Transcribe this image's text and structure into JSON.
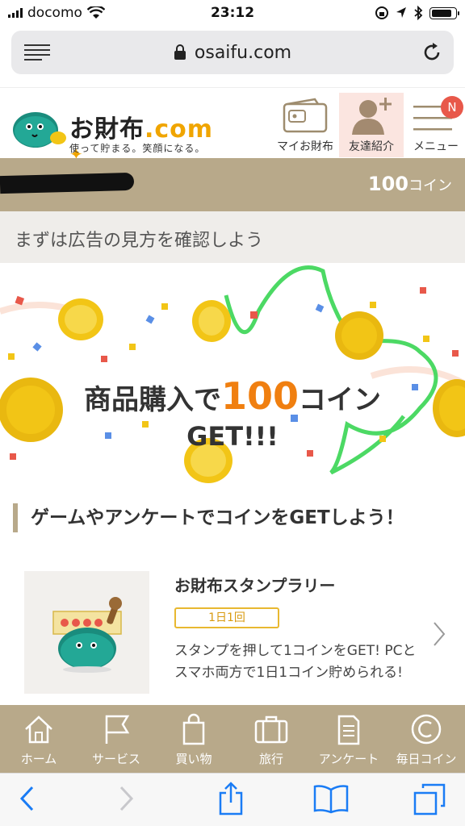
{
  "status_bar": {
    "carrier": "docomo",
    "time": "23:12",
    "battery_level": 0.85
  },
  "browser": {
    "url": "osaifu.com"
  },
  "header": {
    "brand": "お財布",
    "brand_com": ".com",
    "tagline": "使って貯まる。笑顔になる。",
    "nav": [
      {
        "label": "マイお財布",
        "icon": "wallet-icon"
      },
      {
        "label": "友達紹介",
        "icon": "person-add-icon"
      },
      {
        "label": "メニュー",
        "icon": "hamburger-icon",
        "badge": "N"
      }
    ]
  },
  "coin_bar": {
    "amount": "100",
    "unit": "コイン"
  },
  "notice": "まずは広告の見方を確認しよう",
  "banner": {
    "line1_pre": "商品購入で",
    "line1_num": "100",
    "line1_post": "コイン",
    "line2": "GET!!!"
  },
  "section_title": "ゲームやアンケートでコインをGETしよう！",
  "card": {
    "title": "お財布スタンプラリー",
    "frequency": "1日1回",
    "description": "スタンプを押して1コインをGET! PCとスマホ両方で1日1コイン貯められる!"
  },
  "bottom_nav": [
    {
      "label": "ホーム",
      "icon": "home-icon"
    },
    {
      "label": "サービス",
      "icon": "flag-icon"
    },
    {
      "label": "買い物",
      "icon": "shopping-bag-icon"
    },
    {
      "label": "旅行",
      "icon": "suitcase-icon"
    },
    {
      "label": "アンケート",
      "icon": "survey-icon"
    },
    {
      "label": "毎日コイン",
      "icon": "coin-c-icon"
    }
  ],
  "colors": {
    "accent": "#b8a98a",
    "orange": "#f07f10",
    "badge": "#e8584a"
  }
}
